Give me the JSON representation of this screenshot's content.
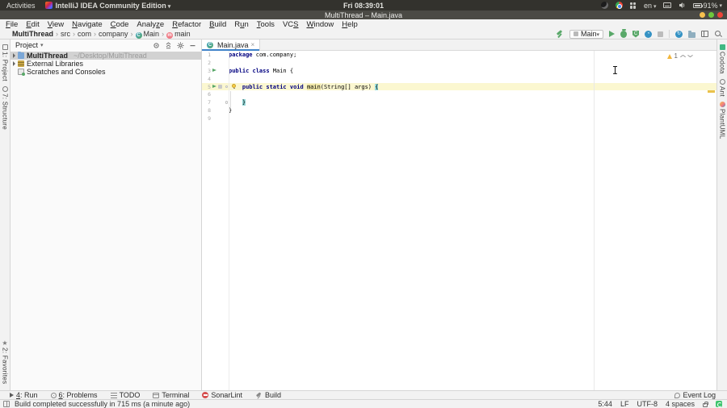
{
  "colors": {
    "accent_blue": "#4083c9",
    "keyword": "#000080",
    "caret_line_bg": "#fbf7d0",
    "brace_match_bg": "#93d9d9",
    "identifier_highlight_bg": "#efe6a8",
    "run_green": "#59a869",
    "warning_yellow": "#f2b63c",
    "sonarlint_red": "#d64f4f",
    "chrome_bg": "#f2f2f2"
  },
  "gnome_bar": {
    "activities_label": "Activities",
    "app_menu_label": "IntelliJ IDEA Community Edition",
    "clock": "Fri 08:39:01",
    "keyboard_layout": "en",
    "battery_percent": "91%",
    "tray_icons": [
      "recorder-icon",
      "chrome-icon",
      "extensions-icon",
      "keyboard-layout-icon",
      "keyboard-icon",
      "volume-icon",
      "battery-icon"
    ]
  },
  "title_bar": {
    "title": "MultiThread – Main.java",
    "window_buttons": [
      "minimize",
      "maximize",
      "close"
    ]
  },
  "menu_bar": {
    "items": [
      {
        "label": "File",
        "m": 0
      },
      {
        "label": "Edit",
        "m": 0
      },
      {
        "label": "View",
        "m": 0
      },
      {
        "label": "Navigate",
        "m": 0
      },
      {
        "label": "Code",
        "m": 0
      },
      {
        "label": "Analyze",
        "m": 5
      },
      {
        "label": "Refactor",
        "m": 0
      },
      {
        "label": "Build",
        "m": 0
      },
      {
        "label": "Run",
        "m": 1
      },
      {
        "label": "Tools",
        "m": 0
      },
      {
        "label": "VCS",
        "m": 2
      },
      {
        "label": "Window",
        "m": 0
      },
      {
        "label": "Help",
        "m": 0
      }
    ]
  },
  "nav_bar": {
    "breadcrumbs": [
      "MultiThread",
      "src",
      "com",
      "company",
      "Main",
      "main"
    ],
    "run_config": "Main",
    "toolbar_icons": [
      "build-hammer-icon",
      "run-icon",
      "debug-icon",
      "coverage-icon",
      "profiler-icon",
      "stop-icon",
      "update-icon",
      "project-structure-icon",
      "layout-icon",
      "search-everywhere-icon"
    ]
  },
  "tool_window_stripes": {
    "left_top": [
      "1: Project",
      "7: Structure"
    ],
    "left_bottom": [
      "2: Favorites"
    ],
    "right": [
      "Codota",
      "Ant",
      "PlantUML"
    ]
  },
  "project_panel": {
    "header": "Project",
    "header_icons": [
      "locate-icon",
      "collapse-all-icon",
      "settings-icon",
      "hide-icon"
    ],
    "tree": [
      {
        "label": "MultiThread",
        "path": "~/Desktop/MultiThread"
      },
      {
        "label": "External Libraries",
        "path": ""
      },
      {
        "label": "Scratches and Consoles",
        "path": ""
      }
    ]
  },
  "editor": {
    "tab": {
      "label": "Main.java",
      "close": "×"
    },
    "inspections": {
      "warnings": "1"
    },
    "lines": [
      {
        "num": "1",
        "tokens": [
          {
            "t": "kw",
            "s": "package"
          },
          {
            "t": "pl",
            "s": " com.company;"
          }
        ]
      },
      {
        "num": "2",
        "tokens": []
      },
      {
        "num": "3",
        "gutter_run": true,
        "tokens": [
          {
            "t": "kw",
            "s": "public class"
          },
          {
            "t": "pl",
            "s": " Main {"
          }
        ]
      },
      {
        "num": "4",
        "tokens": []
      },
      {
        "num": "5",
        "gutter_run": true,
        "gutter_extra": true,
        "fold": true,
        "bulb": true,
        "caret": true,
        "tokens": [
          {
            "t": "pl",
            "s": "    "
          },
          {
            "t": "kw",
            "s": "public static void"
          },
          {
            "t": "pl",
            "s": " "
          },
          {
            "t": "hl",
            "s": "main"
          },
          {
            "t": "pl",
            "s": "(String[] args) "
          },
          {
            "t": "brace",
            "s": "{"
          }
        ]
      },
      {
        "num": "6",
        "tokens": []
      },
      {
        "num": "7",
        "fold": true,
        "tokens": [
          {
            "t": "pl",
            "s": "    "
          },
          {
            "t": "brace",
            "s": "}"
          }
        ]
      },
      {
        "num": "8",
        "tokens": [
          {
            "t": "pl",
            "s": "}"
          }
        ]
      },
      {
        "num": "9",
        "tokens": []
      }
    ]
  },
  "bottom_bar": {
    "tabs": [
      {
        "label": "4: Run",
        "m": 0
      },
      {
        "label": "6: Problems",
        "m": 0
      },
      {
        "label": "TODO",
        "m": null
      },
      {
        "label": "Terminal",
        "m": null
      },
      {
        "label": "SonarLint",
        "m": null
      },
      {
        "label": "Build",
        "m": null
      }
    ],
    "event_log": "Event Log"
  },
  "status_bar": {
    "message": "Build completed successfully in 715 ms (a minute ago)",
    "caret_position": "5:44",
    "line_separator": "LF",
    "encoding": "UTF-8",
    "indent": "4 spaces"
  }
}
